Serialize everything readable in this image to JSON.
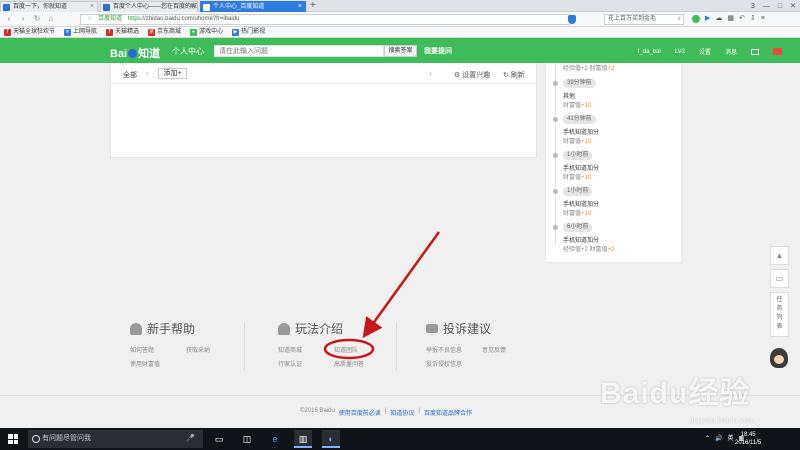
{
  "browser": {
    "tabs": [
      {
        "label": "百度一下，你就知道"
      },
      {
        "label": "百度个人中心——您在百度的家"
      },
      {
        "label": "个人中心_百度知道"
      }
    ],
    "new_tab": "+",
    "window_controls": [
      "3",
      "—",
      "□",
      "✕"
    ],
    "nav": {
      "back": "‹",
      "forward": "›",
      "reload": "↻",
      "home": "⌂"
    },
    "address": {
      "star": "☆",
      "site_name": "百度知道",
      "url_scheme": "https",
      "url_rest": "://zhidao.baidu.com/uhome?fr=ibaidu"
    },
    "search_box": "花上百万买到金毛",
    "bookmarks": [
      {
        "label": "天猫全球狂欢节",
        "color": "#d92a2a",
        "glyph": "T"
      },
      {
        "label": "上网导航",
        "color": "#2e7ce0",
        "glyph": "e"
      },
      {
        "label": "天猫精选",
        "color": "#d92a2a",
        "glyph": "T"
      },
      {
        "label": "京东商城",
        "color": "#d92a2a",
        "glyph": "京"
      },
      {
        "label": "游戏中心",
        "color": "#3ebc5a",
        "glyph": "●"
      },
      {
        "label": "热门影视",
        "color": "#2e7ce0",
        "glyph": "▶"
      }
    ]
  },
  "header": {
    "logo": {
      "left": "Bai",
      "right": "知道"
    },
    "title": "个人中心",
    "search_placeholder": "请在此输入问题",
    "search_button": "搜索答案",
    "ask_button": "我要提问",
    "username": "l_da_bai",
    "level": "LV2",
    "settings": "设置",
    "messages": "消息",
    "brand_color": "#3ebc5a"
  },
  "filter": {
    "all": "全部",
    "add": "添加+",
    "set_interest": "⚙ 设置兴趣",
    "refresh": "↻ 刷新"
  },
  "timeline": [
    {
      "time": "",
      "title": "",
      "reward_label": "经验值+2 财富值",
      "reward_value": "+2"
    },
    {
      "time": "39分钟前",
      "title": "其他",
      "reward_label": "财富值",
      "reward_value": "+10"
    },
    {
      "time": "41分钟前",
      "title": "手机知道加分",
      "reward_label": "财富值",
      "reward_value": "+10"
    },
    {
      "time": "1小时前",
      "title": "手机知道加分",
      "reward_label": "财富值",
      "reward_value": "+10"
    },
    {
      "time": "1小时前",
      "title": "手机知道加分",
      "reward_label": "财富值",
      "reward_value": "+10"
    },
    {
      "time": "6小时前",
      "title": "手机知道加分",
      "reward_label": "经验值+2 财富值",
      "reward_value": "+2"
    }
  ],
  "footer": {
    "sections": [
      {
        "title": "新手帮助",
        "icon": "person-icon",
        "links": [
          "如何答题",
          "获取采纳",
          "使用财富值"
        ]
      },
      {
        "title": "玩法介绍",
        "icon": "person-icon",
        "links": [
          "知道商城",
          "知道团队",
          "行家认证",
          "高质量问答"
        ]
      },
      {
        "title": "投诉建议",
        "icon": "mail-icon",
        "links": [
          "举报不良信息",
          "意见反馈",
          "投诉侵权信息"
        ]
      }
    ],
    "copyright": "©2016 Baidu",
    "bottom_links": [
      "使用百度前必读",
      "知道协议",
      "百度知道品牌合作"
    ],
    "separator": "|"
  },
  "float_tools": {
    "top": "▲",
    "feedback": "▭",
    "tasks": "任务列表"
  },
  "annotation": {
    "arrow_color": "#c8161d"
  },
  "watermark": {
    "text": "Baidu经验",
    "url": "jingyan.baidu.com"
  },
  "taskbar": {
    "search_placeholder": "有问题尽管问我",
    "mic": "🎤",
    "apps": [
      "▭",
      "◫",
      "e",
      "▥",
      "◐"
    ],
    "tray": [
      "⌃",
      "🔊",
      "英",
      "▦"
    ],
    "time": "18:45",
    "date": "2016/11/5"
  }
}
